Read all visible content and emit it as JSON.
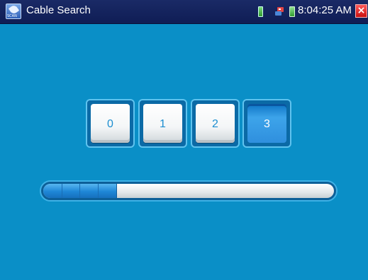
{
  "window": {
    "title": "Cable Search",
    "app_icon_caption": "SCAN",
    "time": "8:04:25 AM",
    "close_label": "×"
  },
  "status_icons": [
    "sim-icon",
    "usb-icon",
    "battery-icon"
  ],
  "digits": [
    {
      "label": "0",
      "active": false
    },
    {
      "label": "1",
      "active": false
    },
    {
      "label": "2",
      "active": false
    },
    {
      "label": "3",
      "active": true
    }
  ],
  "progress": {
    "fraction": 0.25
  },
  "colors": {
    "background": "#0a8fc7",
    "titlebar": "#13215c",
    "active_digit": "#2f8fde",
    "progress_fill": "#1e86d6",
    "close": "#e02020"
  }
}
